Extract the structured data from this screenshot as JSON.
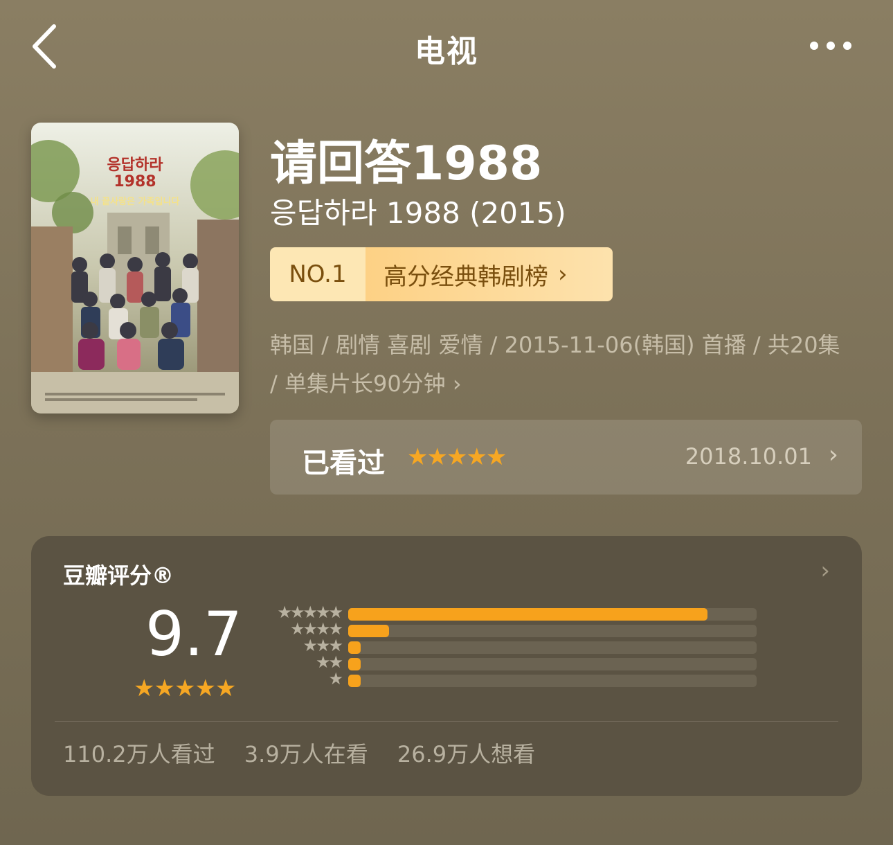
{
  "nav": {
    "title": "电视",
    "back_icon": "chevron-left-icon",
    "more_icon": "more-horizontal-icon"
  },
  "show": {
    "title": "请回答1988",
    "original_title": "응답하라 1988 (2015)",
    "poster": {
      "logo_line1": "응답하라",
      "logo_line2": "1988",
      "tagline": "내 끝사랑은 가족입니다"
    },
    "info": "韩国 / 剧情 喜剧 爱情 / 2015-11-06(韩国) 首播 / 共20集 / 单集片长90分钟"
  },
  "rank": {
    "number": "NO.1",
    "name": "高分经典韩剧榜",
    "chevron": "›"
  },
  "watched": {
    "label": "已看过",
    "stars": "★★★★★",
    "rating": 5,
    "date": "2018.10.01",
    "chevron": "›"
  },
  "rating_card": {
    "title": "豆瓣评分®",
    "chevron": "›",
    "score": "9.7",
    "score_stars": "★★★★★",
    "distribution": [
      {
        "stars": "★★★★★",
        "fraction": 0.88
      },
      {
        "stars": "★★★★",
        "fraction": 0.1
      },
      {
        "stars": "★★★",
        "fraction": 0.03
      },
      {
        "stars": "★★",
        "fraction": 0.03
      },
      {
        "stars": "★",
        "fraction": 0.03
      }
    ],
    "stats": [
      "110.2万人看过",
      "3.9万人在看",
      "26.9万人想看"
    ]
  },
  "colors": {
    "accent_star": "#f6a723",
    "bar_fill": "#f7a21c",
    "card_bg": "#5b5343",
    "rank_text": "#7a4f0e"
  }
}
